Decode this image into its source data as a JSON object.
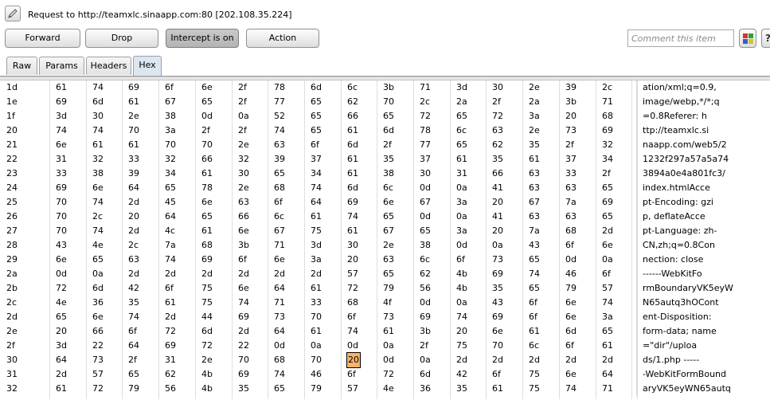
{
  "request": {
    "title": "Request to http://teamxlc.sinaapp.com:80  [202.108.35.224]"
  },
  "toolbar": {
    "forward": "Forward",
    "drop": "Drop",
    "intercept": "Intercept is on",
    "action": "Action",
    "comment_placeholder": "Comment this item",
    "help": "?"
  },
  "tabs": [
    "Raw",
    "Params",
    "Headers",
    "Hex"
  ],
  "active_tab": "Hex",
  "colors": {
    "active_tab_bg": "#dde6ef",
    "selected_cell_bg": "#f7b36a"
  },
  "hex_rows": [
    {
      "addr": "1d",
      "bytes": [
        "61",
        "74",
        "69",
        "6f",
        "6e",
        "2f",
        "78",
        "6d",
        "6c",
        "3b",
        "71",
        "3d",
        "30",
        "2e",
        "39",
        "2c"
      ],
      "ascii": "ation/xml;q=0.9,"
    },
    {
      "addr": "1e",
      "bytes": [
        "69",
        "6d",
        "61",
        "67",
        "65",
        "2f",
        "77",
        "65",
        "62",
        "70",
        "2c",
        "2a",
        "2f",
        "2a",
        "3b",
        "71"
      ],
      "ascii": "image/webp,*/*;q"
    },
    {
      "addr": "1f",
      "bytes": [
        "3d",
        "30",
        "2e",
        "38",
        "0d",
        "0a",
        "52",
        "65",
        "66",
        "65",
        "72",
        "65",
        "72",
        "3a",
        "20",
        "68"
      ],
      "ascii": "=0.8Referer: h"
    },
    {
      "addr": "20",
      "bytes": [
        "74",
        "74",
        "70",
        "3a",
        "2f",
        "2f",
        "74",
        "65",
        "61",
        "6d",
        "78",
        "6c",
        "63",
        "2e",
        "73",
        "69"
      ],
      "ascii": "ttp://teamxlc.si"
    },
    {
      "addr": "21",
      "bytes": [
        "6e",
        "61",
        "61",
        "70",
        "70",
        "2e",
        "63",
        "6f",
        "6d",
        "2f",
        "77",
        "65",
        "62",
        "35",
        "2f",
        "32"
      ],
      "ascii": "naapp.com/web5/2"
    },
    {
      "addr": "22",
      "bytes": [
        "31",
        "32",
        "33",
        "32",
        "66",
        "32",
        "39",
        "37",
        "61",
        "35",
        "37",
        "61",
        "35",
        "61",
        "37",
        "34"
      ],
      "ascii": "1232f297a57a5a74"
    },
    {
      "addr": "23",
      "bytes": [
        "33",
        "38",
        "39",
        "34",
        "61",
        "30",
        "65",
        "34",
        "61",
        "38",
        "30",
        "31",
        "66",
        "63",
        "33",
        "2f"
      ],
      "ascii": "3894a0e4a801fc3/"
    },
    {
      "addr": "24",
      "bytes": [
        "69",
        "6e",
        "64",
        "65",
        "78",
        "2e",
        "68",
        "74",
        "6d",
        "6c",
        "0d",
        "0a",
        "41",
        "63",
        "63",
        "65"
      ],
      "ascii": "index.htmlAcce"
    },
    {
      "addr": "25",
      "bytes": [
        "70",
        "74",
        "2d",
        "45",
        "6e",
        "63",
        "6f",
        "64",
        "69",
        "6e",
        "67",
        "3a",
        "20",
        "67",
        "7a",
        "69"
      ],
      "ascii": "pt-Encoding: gzi"
    },
    {
      "addr": "26",
      "bytes": [
        "70",
        "2c",
        "20",
        "64",
        "65",
        "66",
        "6c",
        "61",
        "74",
        "65",
        "0d",
        "0a",
        "41",
        "63",
        "63",
        "65"
      ],
      "ascii": "p, deflateAcce"
    },
    {
      "addr": "27",
      "bytes": [
        "70",
        "74",
        "2d",
        "4c",
        "61",
        "6e",
        "67",
        "75",
        "61",
        "67",
        "65",
        "3a",
        "20",
        "7a",
        "68",
        "2d"
      ],
      "ascii": "pt-Language: zh-"
    },
    {
      "addr": "28",
      "bytes": [
        "43",
        "4e",
        "2c",
        "7a",
        "68",
        "3b",
        "71",
        "3d",
        "30",
        "2e",
        "38",
        "0d",
        "0a",
        "43",
        "6f",
        "6e"
      ],
      "ascii": "CN,zh;q=0.8Con"
    },
    {
      "addr": "29",
      "bytes": [
        "6e",
        "65",
        "63",
        "74",
        "69",
        "6f",
        "6e",
        "3a",
        "20",
        "63",
        "6c",
        "6f",
        "73",
        "65",
        "0d",
        "0a"
      ],
      "ascii": "nection: close"
    },
    {
      "addr": "2a",
      "bytes": [
        "0d",
        "0a",
        "2d",
        "2d",
        "2d",
        "2d",
        "2d",
        "2d",
        "57",
        "65",
        "62",
        "4b",
        "69",
        "74",
        "46",
        "6f"
      ],
      "ascii": "------WebKitFo"
    },
    {
      "addr": "2b",
      "bytes": [
        "72",
        "6d",
        "42",
        "6f",
        "75",
        "6e",
        "64",
        "61",
        "72",
        "79",
        "56",
        "4b",
        "35",
        "65",
        "79",
        "57"
      ],
      "ascii": "rmBoundaryVK5eyW"
    },
    {
      "addr": "2c",
      "bytes": [
        "4e",
        "36",
        "35",
        "61",
        "75",
        "74",
        "71",
        "33",
        "68",
        "4f",
        "0d",
        "0a",
        "43",
        "6f",
        "6e",
        "74"
      ],
      "ascii": "N65autq3hOCont"
    },
    {
      "addr": "2d",
      "bytes": [
        "65",
        "6e",
        "74",
        "2d",
        "44",
        "69",
        "73",
        "70",
        "6f",
        "73",
        "69",
        "74",
        "69",
        "6f",
        "6e",
        "3a"
      ],
      "ascii": "ent-Disposition:"
    },
    {
      "addr": "2e",
      "bytes": [
        "20",
        "66",
        "6f",
        "72",
        "6d",
        "2d",
        "64",
        "61",
        "74",
        "61",
        "3b",
        "20",
        "6e",
        "61",
        "6d",
        "65"
      ],
      "ascii": " form-data; name"
    },
    {
      "addr": "2f",
      "bytes": [
        "3d",
        "22",
        "64",
        "69",
        "72",
        "22",
        "0d",
        "0a",
        "0d",
        "0a",
        "2f",
        "75",
        "70",
        "6c",
        "6f",
        "61"
      ],
      "ascii": "=\"dir\"/uploa"
    },
    {
      "addr": "30",
      "bytes": [
        "64",
        "73",
        "2f",
        "31",
        "2e",
        "70",
        "68",
        "70",
        "20",
        "0d",
        "0a",
        "2d",
        "2d",
        "2d",
        "2d",
        "2d"
      ],
      "ascii": "ds/1.php -----"
    },
    {
      "addr": "31",
      "bytes": [
        "2d",
        "57",
        "65",
        "62",
        "4b",
        "69",
        "74",
        "46",
        "6f",
        "72",
        "6d",
        "42",
        "6f",
        "75",
        "6e",
        "64"
      ],
      "ascii": "-WebKitFormBound"
    },
    {
      "addr": "32",
      "bytes": [
        "61",
        "72",
        "79",
        "56",
        "4b",
        "35",
        "65",
        "79",
        "57",
        "4e",
        "36",
        "35",
        "61",
        "75",
        "74",
        "71"
      ],
      "ascii": "aryVK5eyWN65autq"
    }
  ],
  "selected_cell": {
    "addr": "30",
    "byte_index": 8
  }
}
